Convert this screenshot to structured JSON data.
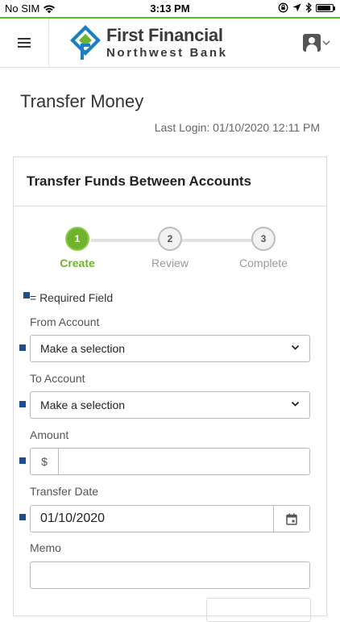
{
  "status_bar": {
    "carrier": "No SIM",
    "time": "3:13 PM",
    "battery_level": 0.9
  },
  "header": {
    "logo_line1": "First Financial",
    "logo_line2": "Northwest Bank",
    "menu_icon": "hamburger-icon",
    "user_icon": "user-account-icon"
  },
  "page": {
    "title": "Transfer Money",
    "last_login": "Last Login: 01/10/2020 12:11 PM"
  },
  "card": {
    "title": "Transfer Funds Between Accounts",
    "steps": [
      {
        "number": "1",
        "label": "Create"
      },
      {
        "number": "2",
        "label": "Review"
      },
      {
        "number": "3",
        "label": "Complete"
      }
    ],
    "required_legend": "= Required Field",
    "from_account": {
      "label": "From Account",
      "value": "Make a selection"
    },
    "to_account": {
      "label": "To Account",
      "value": "Make a selection"
    },
    "amount": {
      "label": "Amount",
      "prefix": "$",
      "value": ""
    },
    "transfer_date": {
      "label": "Transfer Date",
      "value": "01/10/2020",
      "icon": "calendar-icon"
    },
    "memo": {
      "label": "Memo",
      "value": ""
    }
  },
  "colors": {
    "accent_green": "#6fb32c",
    "required_blue": "#1f4e8c",
    "logo_blue": "#1b7fc4"
  }
}
